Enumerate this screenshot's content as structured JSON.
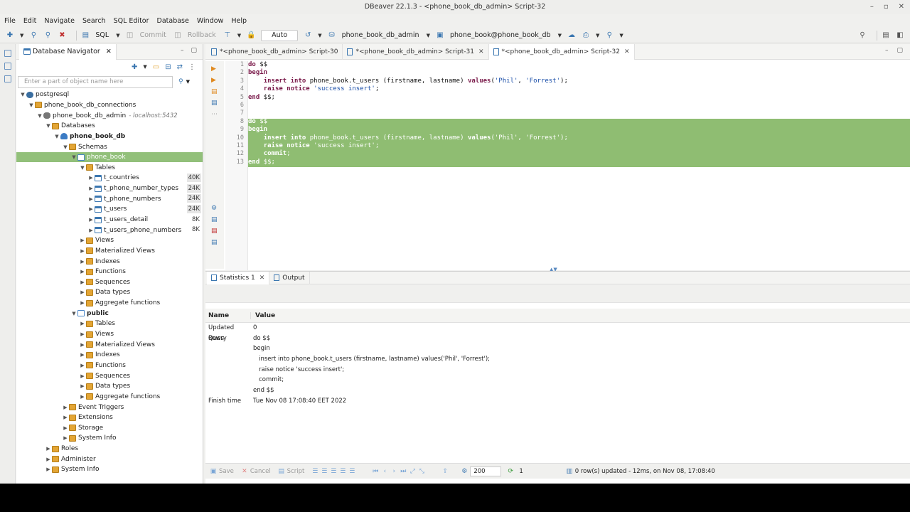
{
  "window": {
    "title": "DBeaver 22.1.3 - <phone_book_db_admin> Script-32"
  },
  "menu": [
    "File",
    "Edit",
    "Navigate",
    "Search",
    "SQL Editor",
    "Database",
    "Window",
    "Help"
  ],
  "toolbar": {
    "sql": "SQL",
    "commit": "Commit",
    "rollback": "Rollback",
    "auto": "Auto",
    "datasource": "phone_book_db_admin",
    "schema": "phone_book@phone_book_db"
  },
  "navigator": {
    "title": "Database Navigator",
    "filter_placeholder": "Enter a part of object name here",
    "tree": [
      {
        "label": "postgresql",
        "depth": 0,
        "arrow": "down",
        "icon": "pg"
      },
      {
        "label": "phone_book_db_connections",
        "depth": 1,
        "arrow": "down",
        "icon": "folder"
      },
      {
        "label": "phone_book_db_admin",
        "host": "- localhost:5432",
        "depth": 2,
        "arrow": "down",
        "icon": "conn"
      },
      {
        "label": "Databases",
        "depth": 3,
        "arrow": "down",
        "icon": "folder"
      },
      {
        "label": "phone_book_db",
        "depth": 4,
        "arrow": "down",
        "icon": "db",
        "bold": true
      },
      {
        "label": "Schemas",
        "depth": 5,
        "arrow": "down",
        "icon": "folder"
      },
      {
        "label": "phone_book",
        "depth": 6,
        "arrow": "down",
        "icon": "schema",
        "selected": true
      },
      {
        "label": "Tables",
        "depth": 7,
        "arrow": "down",
        "icon": "folder"
      },
      {
        "label": "t_countries",
        "depth": 8,
        "arrow": "right",
        "icon": "table",
        "size": "40K",
        "hl": true
      },
      {
        "label": "t_phone_number_types",
        "depth": 8,
        "arrow": "right",
        "icon": "table",
        "size": "24K",
        "hl": true
      },
      {
        "label": "t_phone_numbers",
        "depth": 8,
        "arrow": "right",
        "icon": "table",
        "size": "24K",
        "hl": true
      },
      {
        "label": "t_users",
        "depth": 8,
        "arrow": "right",
        "icon": "table",
        "size": "24K",
        "hl": true
      },
      {
        "label": "t_users_detail",
        "depth": 8,
        "arrow": "right",
        "icon": "table",
        "size": "8K"
      },
      {
        "label": "t_users_phone_numbers",
        "depth": 8,
        "arrow": "right",
        "icon": "table",
        "size": "8K"
      },
      {
        "label": "Views",
        "depth": 7,
        "arrow": "right",
        "icon": "folder"
      },
      {
        "label": "Materialized Views",
        "depth": 7,
        "arrow": "right",
        "icon": "folder"
      },
      {
        "label": "Indexes",
        "depth": 7,
        "arrow": "right",
        "icon": "folder"
      },
      {
        "label": "Functions",
        "depth": 7,
        "arrow": "right",
        "icon": "folder"
      },
      {
        "label": "Sequences",
        "depth": 7,
        "arrow": "right",
        "icon": "folder"
      },
      {
        "label": "Data types",
        "depth": 7,
        "arrow": "right",
        "icon": "folder"
      },
      {
        "label": "Aggregate functions",
        "depth": 7,
        "arrow": "right",
        "icon": "folder"
      },
      {
        "label": "public",
        "depth": 6,
        "arrow": "down",
        "icon": "schema",
        "bold": true
      },
      {
        "label": "Tables",
        "depth": 7,
        "arrow": "right",
        "icon": "folder"
      },
      {
        "label": "Views",
        "depth": 7,
        "arrow": "right",
        "icon": "folder"
      },
      {
        "label": "Materialized Views",
        "depth": 7,
        "arrow": "right",
        "icon": "folder"
      },
      {
        "label": "Indexes",
        "depth": 7,
        "arrow": "right",
        "icon": "folder"
      },
      {
        "label": "Functions",
        "depth": 7,
        "arrow": "right",
        "icon": "folder"
      },
      {
        "label": "Sequences",
        "depth": 7,
        "arrow": "right",
        "icon": "folder"
      },
      {
        "label": "Data types",
        "depth": 7,
        "arrow": "right",
        "icon": "folder"
      },
      {
        "label": "Aggregate functions",
        "depth": 7,
        "arrow": "right",
        "icon": "folder"
      },
      {
        "label": "Event Triggers",
        "depth": 5,
        "arrow": "right",
        "icon": "folder"
      },
      {
        "label": "Extensions",
        "depth": 5,
        "arrow": "right",
        "icon": "folder"
      },
      {
        "label": "Storage",
        "depth": 5,
        "arrow": "right",
        "icon": "folder"
      },
      {
        "label": "System Info",
        "depth": 5,
        "arrow": "right",
        "icon": "folder"
      },
      {
        "label": "Roles",
        "depth": 3,
        "arrow": "right",
        "icon": "folder"
      },
      {
        "label": "Administer",
        "depth": 3,
        "arrow": "right",
        "icon": "folder"
      },
      {
        "label": "System Info",
        "depth": 3,
        "arrow": "right",
        "icon": "folder"
      }
    ]
  },
  "editor": {
    "tabs": [
      {
        "label": "*<phone_book_db_admin> Script-30",
        "active": false,
        "closable": false
      },
      {
        "label": "*<phone_book_db_admin> Script-31",
        "active": false,
        "closable": true
      },
      {
        "label": "*<phone_book_db_admin> Script-32",
        "active": true,
        "closable": true
      }
    ],
    "lines": [
      {
        "n": "1",
        "text": "do $$",
        "kw": [
          "do"
        ]
      },
      {
        "n": "2",
        "text": "begin",
        "kw": [
          "begin"
        ]
      },
      {
        "n": "3",
        "text": "    insert into phone_book.t_users (firstname, lastname) values('Phil', 'Forrest');",
        "kw": [
          "insert",
          "into",
          "values"
        ]
      },
      {
        "n": "4",
        "text": "    raise notice 'success insert';",
        "kw": [
          "raise",
          "notice"
        ]
      },
      {
        "n": "5",
        "text": "end $$;",
        "kw": [
          "end"
        ]
      },
      {
        "n": "6",
        "text": ""
      },
      {
        "n": "7",
        "text": ""
      },
      {
        "n": "8",
        "text": "do $$",
        "kw": [
          "do"
        ],
        "sel": true
      },
      {
        "n": "9",
        "text": "begin",
        "kw": [
          "begin"
        ],
        "sel": true
      },
      {
        "n": "10",
        "text": "    insert into phone_book.t_users (firstname, lastname) values('Phil', 'Forrest');",
        "kw": [
          "insert",
          "into",
          "values"
        ],
        "sel": true
      },
      {
        "n": "11",
        "text": "    raise notice 'success insert';",
        "kw": [
          "raise",
          "notice"
        ],
        "sel": true
      },
      {
        "n": "12",
        "text": "    commit;",
        "kw": [
          "commit"
        ],
        "sel": true
      },
      {
        "n": "13",
        "text": "end $$;",
        "kw": [
          "end"
        ],
        "sel": true
      }
    ]
  },
  "results": {
    "tabs": [
      {
        "label": "Statistics 1",
        "active": true,
        "closable": true
      },
      {
        "label": "Output",
        "active": false,
        "closable": false
      }
    ],
    "header": {
      "name": "Name",
      "value": "Value"
    },
    "rows": [
      {
        "name": "Updated Rows",
        "value": [
          "0"
        ]
      },
      {
        "name": "Query",
        "value": [
          "do $$",
          "begin",
          "   insert into phone_book.t_users (firstname, lastname) values('Phil', 'Forrest');",
          "   raise notice 'success insert';",
          "   commit;",
          "end $$"
        ]
      },
      {
        "name": "Finish time",
        "value": [
          "Tue Nov 08 17:08:40 EET 2022"
        ]
      }
    ]
  },
  "statusbar": {
    "save": "Save",
    "cancel": "Cancel",
    "script": "Script",
    "fetch_size": "200",
    "count": "1",
    "status": "0 row(s) updated - 12ms, on Nov 08, 17:08:40"
  }
}
